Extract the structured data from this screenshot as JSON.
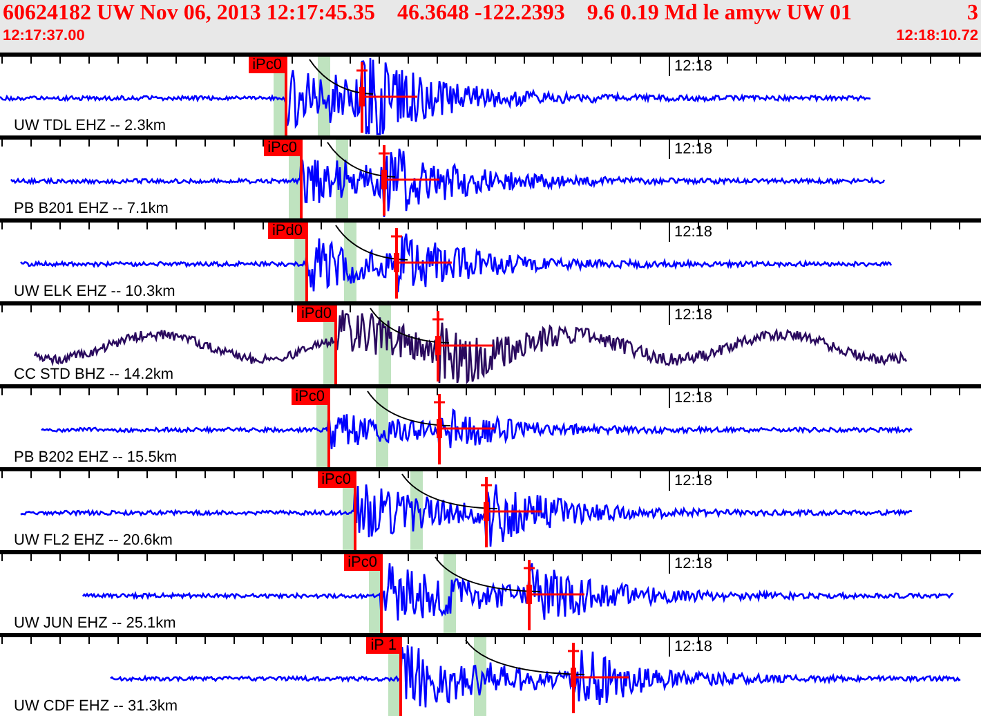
{
  "event_header": {
    "summary_parts": [
      "60624182 UW Nov 06, 2013 12:17:45.35",
      "46.3648 -122.2393",
      "9.6 0.19 Md le amyw UW 01",
      "3"
    ],
    "start_time": "12:17:37.00",
    "end_time": "12:18:10.72"
  },
  "traces": [
    {
      "station": "UW TDL EHZ -- 2.3km",
      "minute_mark": "12:18",
      "pick": "iPc0",
      "kind": "quiet",
      "color": "#0000ff"
    },
    {
      "station": "PB B201 EHZ -- 7.1km",
      "minute_mark": "12:18",
      "pick": "iPc0",
      "kind": "quiet",
      "color": "#0000ff"
    },
    {
      "station": "UW ELK EHZ -- 10.3km",
      "minute_mark": "12:18",
      "pick": "iPd0",
      "kind": "quiet",
      "color": "#0000ff"
    },
    {
      "station": "CC STD BHZ -- 14.2km",
      "minute_mark": "12:18",
      "pick": "iPd0",
      "kind": "microseism",
      "color": "#2a0a5e"
    },
    {
      "station": "PB B202 EHZ -- 15.5km",
      "minute_mark": "12:18",
      "pick": "iPc0",
      "kind": "quiet",
      "color": "#0000ff"
    },
    {
      "station": "UW FL2 EHZ -- 20.6km",
      "minute_mark": "12:18",
      "pick": "iPc0",
      "kind": "quiet",
      "color": "#0000ff"
    },
    {
      "station": "UW JUN EHZ -- 25.1km",
      "minute_mark": "12:18",
      "pick": "iPc0",
      "kind": "quiet",
      "color": "#0000ff"
    },
    {
      "station": "UW CDF EHZ -- 31.3km",
      "minute_mark": "12:18",
      "pick": "iP 1",
      "kind": "quiet",
      "color": "#0000ff"
    }
  ]
}
